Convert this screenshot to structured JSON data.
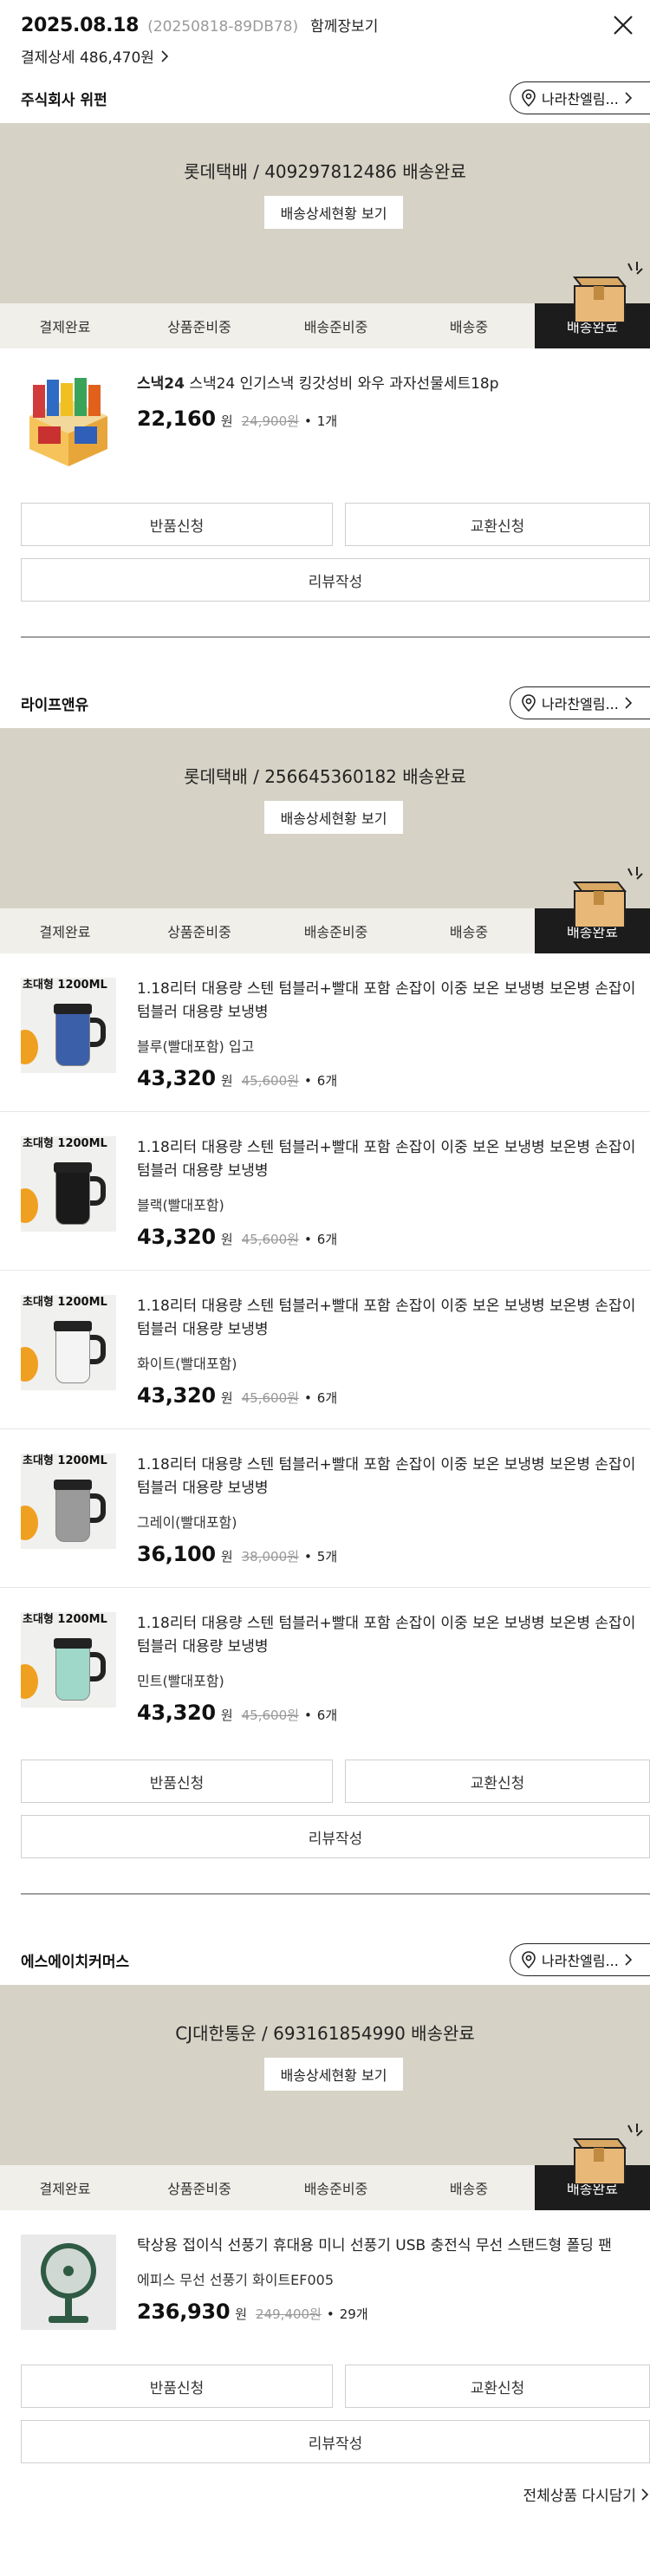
{
  "header": {
    "date": "2025.08.18",
    "order_no": "(20250818-89DB78)",
    "together": "함께장보기",
    "payment_detail": "결제상세 486,470원"
  },
  "steps": [
    "결제완료",
    "상품준비중",
    "배송준비중",
    "배송중",
    "배송완료"
  ],
  "common": {
    "store_button": "나라찬엘림...",
    "tracking_button": "배송상세현황 보기",
    "return": "반품신청",
    "exchange": "교환신청",
    "review": "리뷰작성",
    "won": "원",
    "dot": "•"
  },
  "sellers": [
    {
      "name": "주식회사 위펀",
      "tracking": "롯데택배 / 409297812486 배송완료",
      "items": [
        {
          "brand": "스낵24",
          "title": " 스낵24 인기스낵 킹갓성비 와우 과자선물세트18p",
          "option": "",
          "price": "22,160",
          "original": "24,900원",
          "qty": "1개"
        }
      ]
    },
    {
      "name": "라이프앤유",
      "tracking": "롯데택배 / 256645360182 배송완료",
      "items": [
        {
          "brand": "",
          "title": "1.18리터 대용량 스텐 텀블러+빨대 포함 손잡이 이중 보온 보냉병 보온병 손잡이 텀블러 대용량 보냉병",
          "option": "블루(빨대포함) 입고",
          "price": "43,320",
          "original": "45,600원",
          "qty": "6개"
        },
        {
          "brand": "",
          "title": "1.18리터 대용량 스텐 텀블러+빨대 포함 손잡이 이중 보온 보냉병 보온병 손잡이 텀블러 대용량 보냉병",
          "option": "블랙(빨대포함)",
          "price": "43,320",
          "original": "45,600원",
          "qty": "6개"
        },
        {
          "brand": "",
          "title": "1.18리터 대용량 스텐 텀블러+빨대 포함 손잡이 이중 보온 보냉병 보온병 손잡이 텀블러 대용량 보냉병",
          "option": "화이트(빨대포함)",
          "price": "43,320",
          "original": "45,600원",
          "qty": "6개"
        },
        {
          "brand": "",
          "title": "1.18리터 대용량 스텐 텀블러+빨대 포함 손잡이 이중 보온 보냉병 보온병 손잡이 텀블러 대용량 보냉병",
          "option": "그레이(빨대포함)",
          "price": "36,100",
          "original": "38,000원",
          "qty": "5개"
        },
        {
          "brand": "",
          "title": "1.18리터 대용량 스텐 텀블러+빨대 포함 손잡이 이중 보온 보냉병 보온병 손잡이 텀블러 대용량 보냉병",
          "option": "민트(빨대포함)",
          "price": "43,320",
          "original": "45,600원",
          "qty": "6개"
        }
      ]
    },
    {
      "name": "에스에이치커머스",
      "tracking": "CJ대한통운 / 693161854990 배송완료",
      "items": [
        {
          "brand": "",
          "title": "탁상용 접이식 선풍기 휴대용 미니 선풍기 USB 충전식 무선 스탠드형 폴딩 팬",
          "option": "에피스 무선 선풍기 화이트EF005",
          "price": "236,930",
          "original": "249,400원",
          "qty": "29개"
        }
      ]
    }
  ],
  "thumb_captions": {
    "tumbler": "초대형 1200ML"
  },
  "tumbler_colors": [
    "#3b5fa8",
    "#1a1a1a",
    "#f4f4f4",
    "#9a9a9a",
    "#9fd8c8"
  ],
  "footer": {
    "reorder": "전체상품 다시담기"
  }
}
